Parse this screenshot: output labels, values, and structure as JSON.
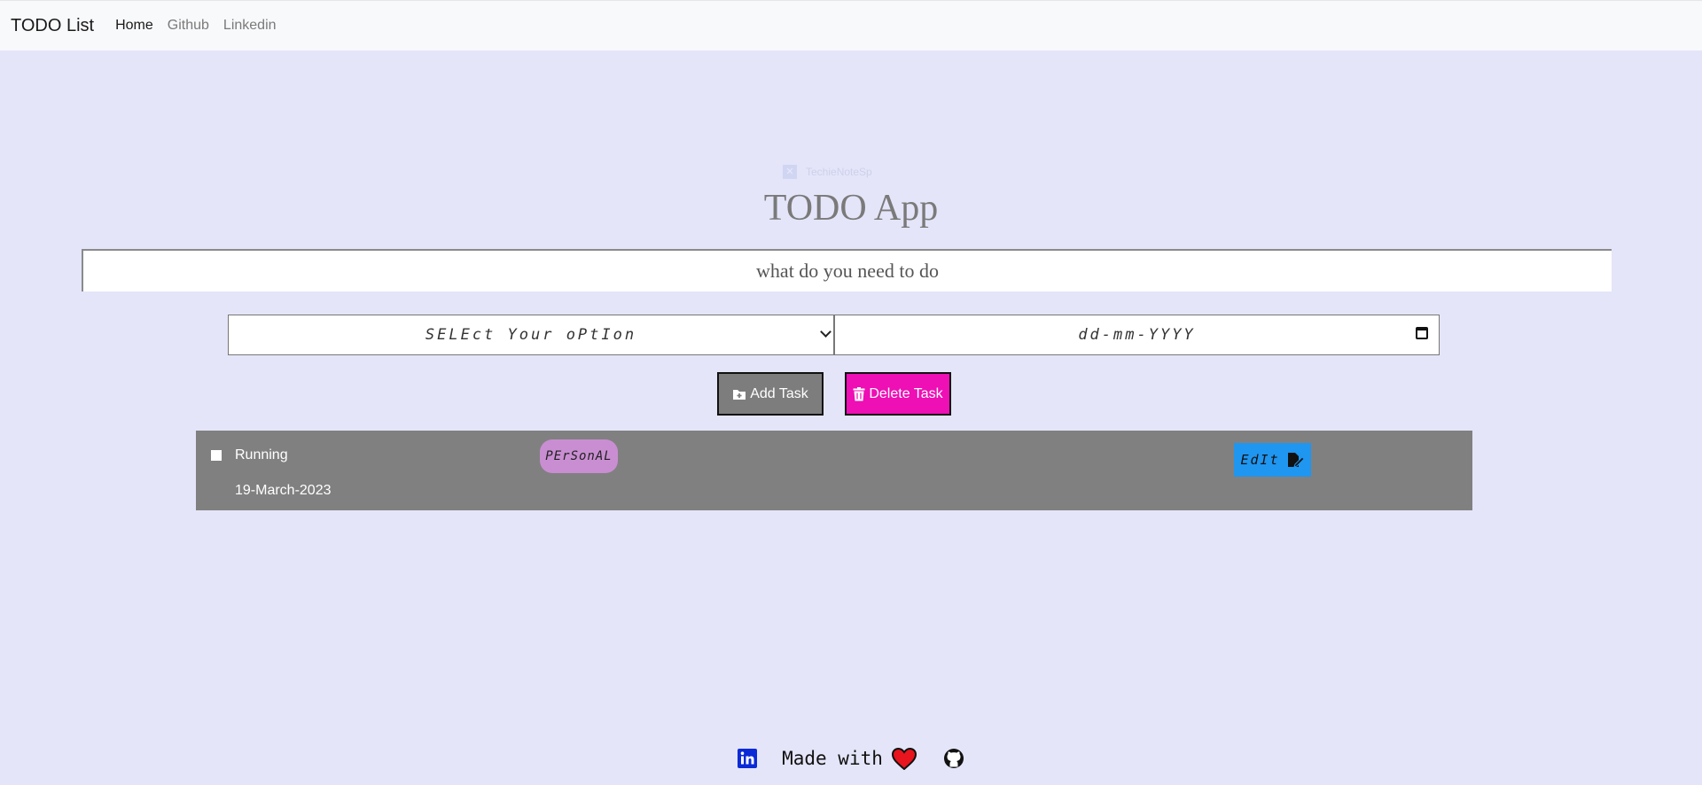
{
  "navbar": {
    "brand": "TODO List",
    "links": [
      {
        "label": "Home"
      },
      {
        "label": "Github"
      },
      {
        "label": "Linkedin"
      }
    ]
  },
  "banner": {
    "text": "TechieNoteSp"
  },
  "app": {
    "title": "TODO App"
  },
  "form": {
    "task_placeholder": "what do you need to do",
    "category_selected": "SELEct Your oPtIon",
    "date_placeholder": "dd-mm-YYYY",
    "add_label": "Add Task",
    "delete_label": "Delete Task"
  },
  "tasks": [
    {
      "name": "Running",
      "date": "19-March-2023",
      "category": "PErSonAL",
      "edit_label": "EdIt"
    }
  ],
  "footer": {
    "text": "Made with"
  },
  "colors": {
    "background": "#e4e5f9",
    "navbar": "#f8f9fb",
    "add_button": "#7d7d7d",
    "delete_button": "#ee0fb5",
    "task_bg": "#808080",
    "tag_bg": "#c98ed2",
    "edit_button": "#1f96f0",
    "heart": "#e8141e",
    "linkedin": "#0a2bd6"
  },
  "icons": {
    "add": "folder-plus-icon",
    "delete": "trash-icon",
    "edit": "file-pen-icon",
    "calendar": "calendar-icon",
    "linkedin": "linkedin-icon",
    "heart": "heart-icon",
    "github": "github-icon"
  }
}
